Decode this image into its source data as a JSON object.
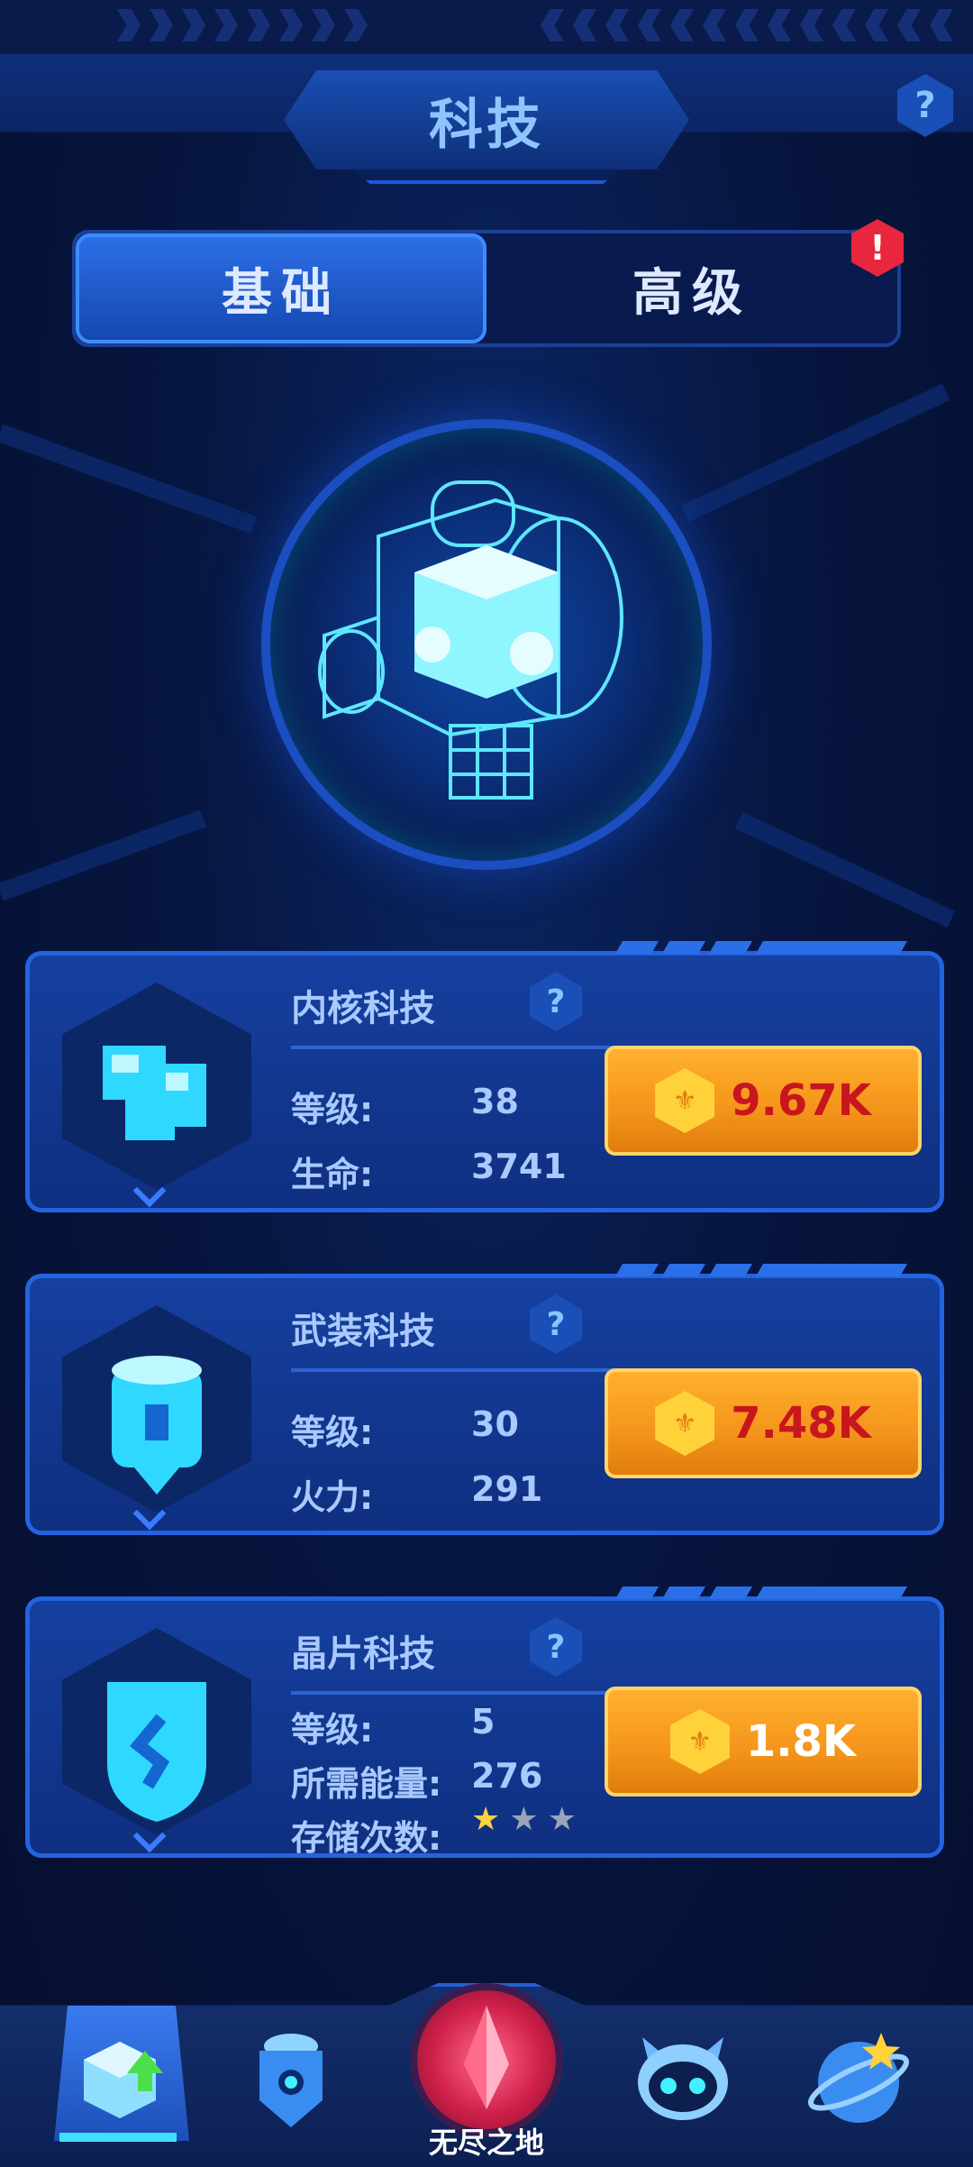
{
  "header": {
    "title": "科技",
    "help_label": "?"
  },
  "tabs": {
    "basic": "基础",
    "advanced": "高级",
    "alert": "!"
  },
  "cards": [
    {
      "name": "内核科技",
      "help": "?",
      "stats": [
        {
          "label": "等级:",
          "value": "38"
        },
        {
          "label": "生命:",
          "value": "3741"
        }
      ],
      "cost": "9.67K"
    },
    {
      "name": "武装科技",
      "help": "?",
      "stats": [
        {
          "label": "等级:",
          "value": "30"
        },
        {
          "label": "火力:",
          "value": "291"
        }
      ],
      "cost": "7.48K"
    },
    {
      "name": "晶片科技",
      "help": "?",
      "stats": [
        {
          "label": "等级:",
          "value": "5"
        },
        {
          "label": "所需能量:",
          "value": "276"
        },
        {
          "label": "存储次数:"
        }
      ],
      "storage_stars": {
        "filled": 1,
        "total": 3
      },
      "cost": "1.8K"
    }
  ],
  "bottom_nav": {
    "center_label": "无尽之地"
  },
  "colors": {
    "accent": "#2463e0",
    "cost_button": "#f4941a",
    "cost_text": "#c8161f",
    "alert": "#e8263d"
  }
}
